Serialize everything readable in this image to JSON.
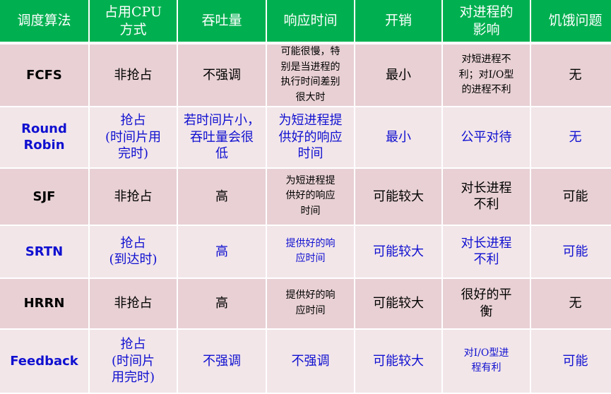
{
  "headers": [
    "调度算法",
    "占用CPU\n方式",
    "吞吐量",
    "响应时间",
    "开销",
    "对进程的\n影响",
    "饥饿问题"
  ],
  "rows": [
    [
      "FCFS",
      "非抢占",
      "不强调",
      "可能很慢，特\n别是当进程的\n执行时间差别\n很大时",
      "最小",
      "对短进程不\n利；对I/O型\n的进程不利",
      "无"
    ],
    [
      "Round\nRobin",
      "抢占\n(时间片用\n完时)",
      "若时间片小，\n吞吐量会很\n低",
      "为短进程提\n供好的响应\n时间",
      "最小",
      "公平对待",
      "无"
    ],
    [
      "SJF",
      "非抢占",
      "高",
      "为短进程提\n供好的响应\n时间",
      "可能较大",
      "对长进程\n不利",
      "可能"
    ],
    [
      "SRTN",
      "抢占\n(到达时)",
      "高",
      "提供好的响\n应时间",
      "可能较大",
      "对长进程\n不利",
      "可能"
    ],
    [
      "HRRN",
      "非抢占",
      "高",
      "提供好的响\n应时间",
      "可能较大",
      "很好的平\n衡",
      "无"
    ],
    [
      "Feedback",
      "抢占\n(时间片\n用完时)",
      "不强调",
      "不强调",
      "可能较大",
      "对I/O型进\n程有利",
      "可能"
    ]
  ],
  "colors": {
    "header": "#00b050",
    "row_odd": "#e8d0d4",
    "row_even": "#f2e6e9",
    "text_even": "#1010d0"
  }
}
